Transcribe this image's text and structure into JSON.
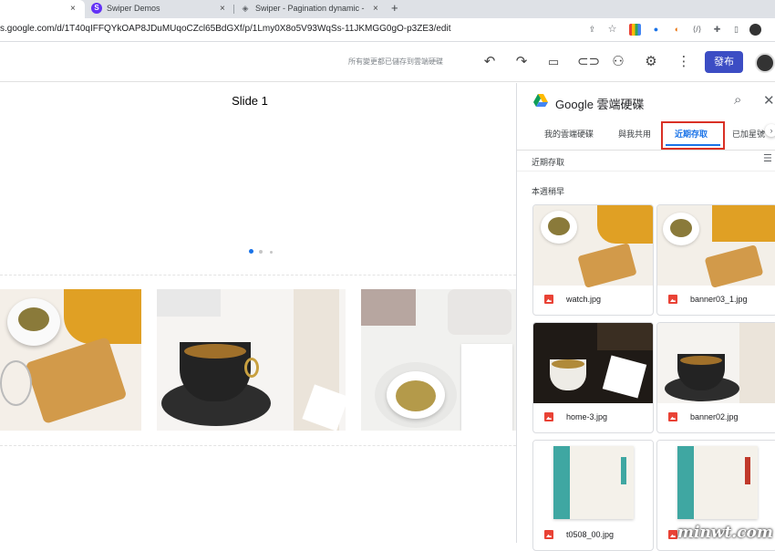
{
  "browser": {
    "tabs": [
      {
        "title": "",
        "close": "×"
      },
      {
        "title": "Swiper Demos",
        "close": "×",
        "favicon": "S"
      },
      {
        "title": "Swiper - Pagination dynamic -",
        "close": "×"
      }
    ],
    "new_tab": "+",
    "url": "s.google.com/d/1T40qIFFQYkOAP8JDuMUqoCZcl65BdGXf/p/1Lmy0X8o5V93WqSs-11JKMGG0gO-p3ZE3/edit"
  },
  "app_header": {
    "save_status": "所有變更都已儲存到雲端硬碟",
    "publish_label": "發布"
  },
  "canvas": {
    "slide_title": "Slide 1",
    "pagination_dots": 3,
    "active_dot": 1
  },
  "drive_panel": {
    "title": "Google 雲端硬碟",
    "tabs": [
      "我的雲端硬碟",
      "與我共用",
      "近期存取",
      "已加星號"
    ],
    "active_tab": "近期存取",
    "section_label": "近期存取",
    "group_label": "本週稍早",
    "files": [
      {
        "name": "watch.jpg"
      },
      {
        "name": "banner03_1.jpg"
      },
      {
        "name": "home-3.jpg"
      },
      {
        "name": "banner02.jpg"
      },
      {
        "name": "t0508_00.jpg"
      },
      {
        "name": ""
      }
    ]
  },
  "watermark": "minwt.com",
  "colors": {
    "accent": "#1a73e8",
    "publish_button": "#3c4dc4",
    "highlight_box": "#d93025",
    "file_icon": "#e94235"
  }
}
